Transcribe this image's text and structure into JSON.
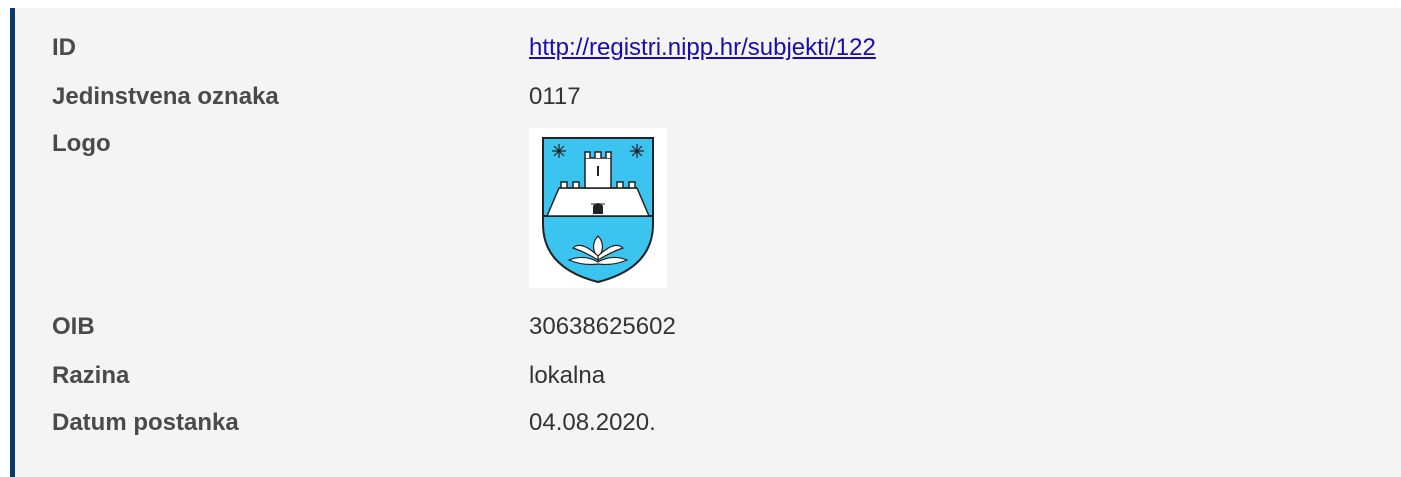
{
  "fields": {
    "id": {
      "label": "ID",
      "value": "http://registri.nipp.hr/subjekti/122"
    },
    "unique_mark": {
      "label": "Jedinstvena oznaka",
      "value": "0117"
    },
    "logo": {
      "label": "Logo",
      "icon": "coat-of-arms-logo"
    },
    "oib": {
      "label": "OIB",
      "value": "30638625602"
    },
    "level": {
      "label": "Razina",
      "value": "lokalna"
    },
    "founding_date": {
      "label": "Datum postanka",
      "value": "04.08.2020."
    }
  },
  "colors": {
    "accent_border": "#0b3a6e",
    "panel_background": "#f4f4f4",
    "link": "#1a0dab",
    "logo_sky": "#3cc4f0"
  }
}
